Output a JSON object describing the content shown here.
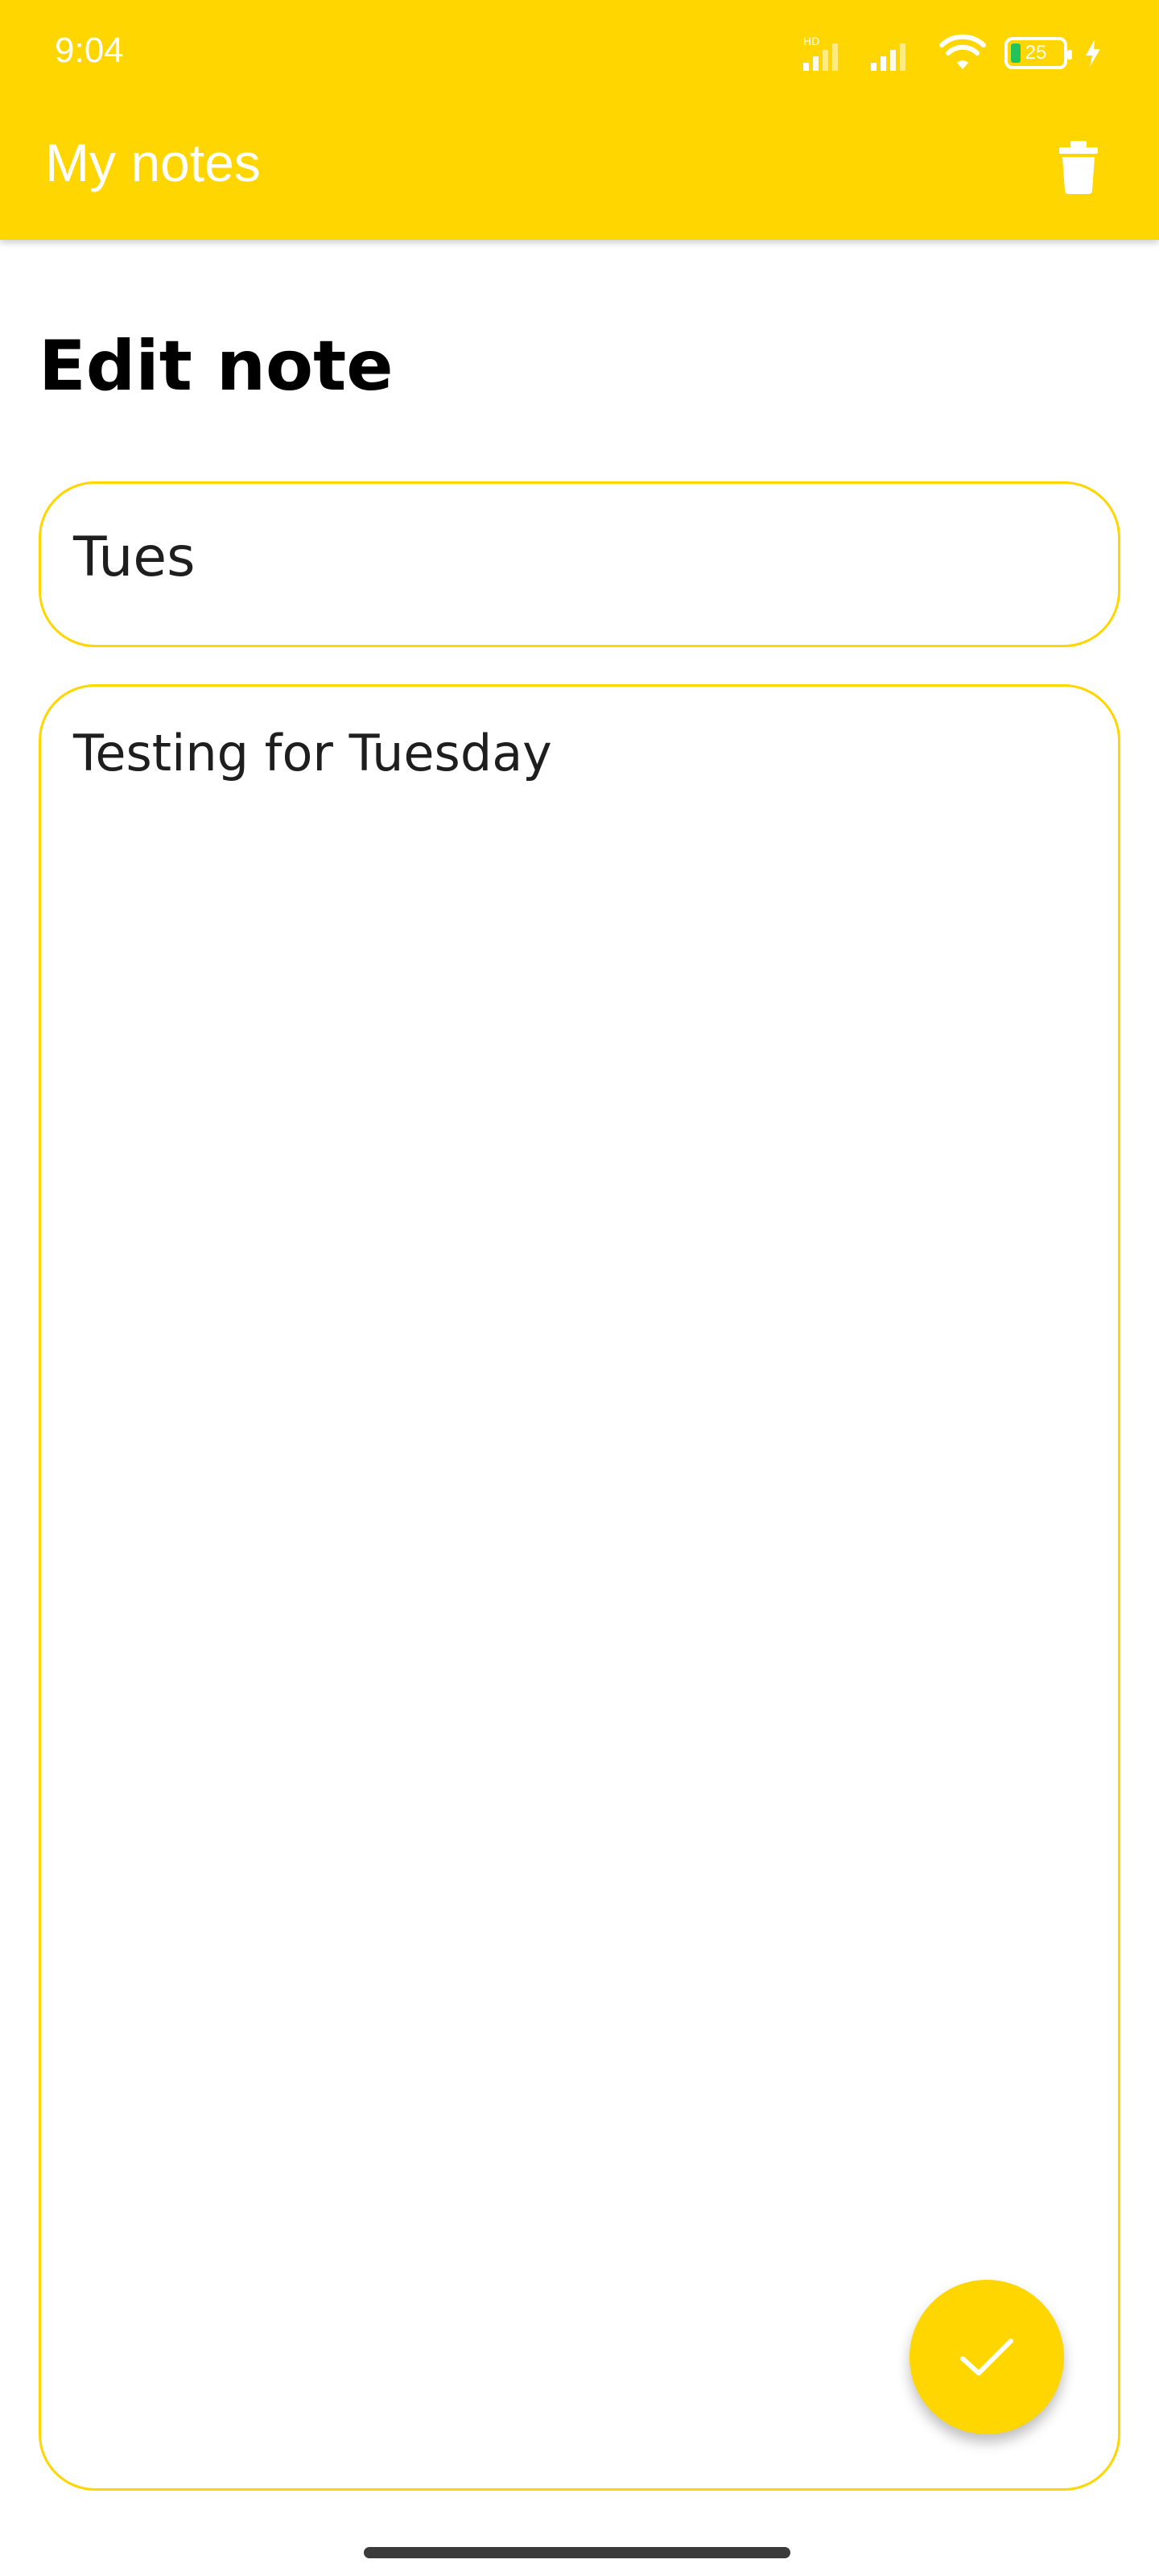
{
  "status_bar": {
    "time": "9:04",
    "battery_percent": "25",
    "network_label": "HD"
  },
  "toolbar": {
    "title": "My notes"
  },
  "editor": {
    "heading": "Edit note",
    "title_value": "Tues",
    "body_value": "Testing for Tuesday"
  },
  "colors": {
    "accent": "#FFD600",
    "text_dark": "#1E1E1E",
    "battery_fill": "#21C35A"
  },
  "icons": {
    "delete": "trash-icon",
    "save": "check-icon"
  }
}
